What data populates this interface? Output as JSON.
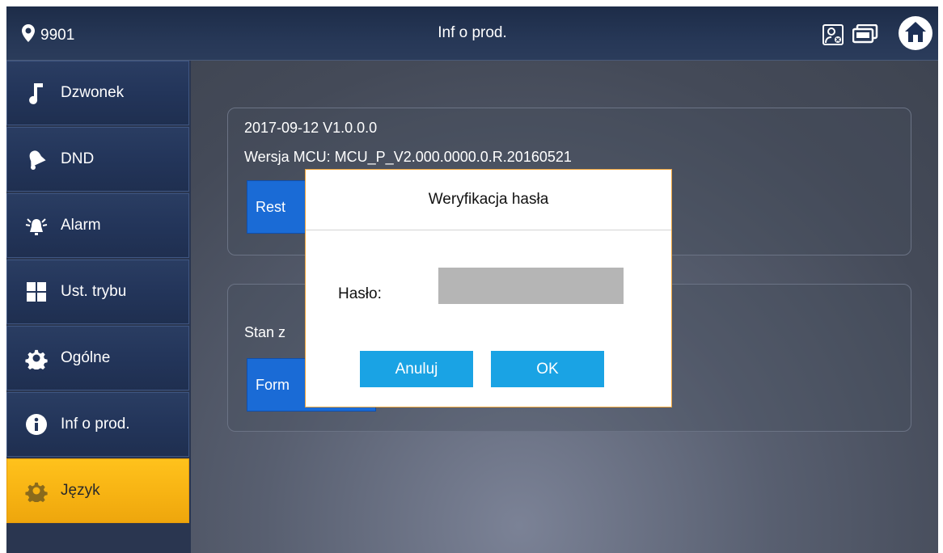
{
  "header": {
    "location": "9901",
    "title": "Inf o prod.",
    "icons": [
      "location-pin-icon",
      "contact-card-icon",
      "monitor-icon",
      "home-icon"
    ]
  },
  "sidebar": {
    "items": [
      {
        "label": "Dzwonek",
        "icon": "music-note-icon",
        "active": false
      },
      {
        "label": "DND",
        "icon": "bell-icon",
        "active": false
      },
      {
        "label": "Alarm",
        "icon": "alarm-icon",
        "active": false
      },
      {
        "label": "Ust. trybu",
        "icon": "grid-icon",
        "active": false
      },
      {
        "label": "Ogólne",
        "icon": "gear-icon",
        "active": false
      },
      {
        "label": "Inf o prod.",
        "icon": "info-icon",
        "active": false
      },
      {
        "label": "Język",
        "icon": "gear-icon",
        "active": true
      }
    ]
  },
  "main": {
    "version": "2017-09-12 V1.0.0.0",
    "mcu_version": "Wersja MCU: MCU_P_V2.000.0000.0.R.20160521",
    "restart_button": "Rest",
    "sd_status": "Stan z",
    "format_button": "Form"
  },
  "dialog": {
    "title": "Weryfikacja hasła",
    "password_label": "Hasło:",
    "password_value": "",
    "cancel_label": "Anuluj",
    "ok_label": "OK"
  },
  "colors": {
    "accent": "#f7b313",
    "dialog_button": "#1aa3e4",
    "dialog_border": "#f0a53b",
    "primary_button": "#1a6bd6"
  }
}
